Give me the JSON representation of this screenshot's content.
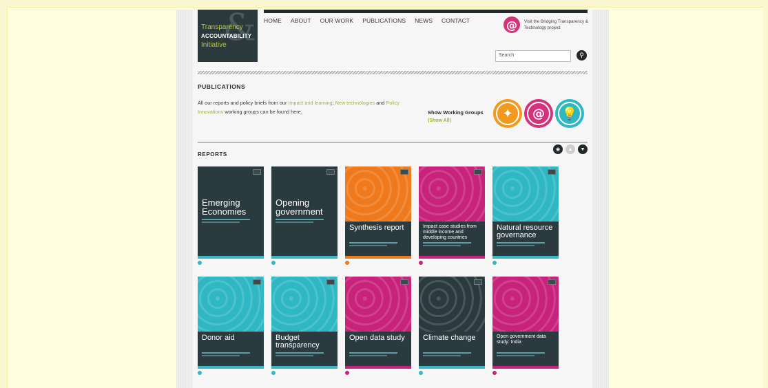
{
  "logo": {
    "line1": "Transparency",
    "line2": "ACCOUNTABILITY",
    "line3": "Initiative",
    "amp": "&"
  },
  "nav": [
    "HOME",
    "ABOUT",
    "OUR WORK",
    "PUBLICATIONS",
    "NEWS",
    "CONTACT"
  ],
  "bridge": {
    "text": "Visit the Bridging Transparency & Technology project",
    "icon": "at-icon"
  },
  "search": {
    "placeholder": "Search"
  },
  "publications": {
    "heading": "PUBLICATIONS",
    "intro_before": "All our reports and policy briefs from our ",
    "link1": "Impact and learning",
    "sep1": "; ",
    "link2": "New technologies",
    "and": " and ",
    "link3": "Policy Innovations",
    "intro_after": " working groups can be found here.",
    "show_groups": "Show Working Groups",
    "show_all": "(Show All)",
    "groups": [
      {
        "name": "compass-icon",
        "color": "#f29a1f",
        "glyph": "✦"
      },
      {
        "name": "at-icon",
        "color": "#d5327c",
        "glyph": "@"
      },
      {
        "name": "lightbulb-icon",
        "color": "#2fb8c4",
        "glyph": "💡"
      }
    ]
  },
  "reports": {
    "heading": "REPORTS",
    "controls": [
      {
        "name": "rss-icon",
        "glyph": "◉",
        "color": "#23292b"
      },
      {
        "name": "up-arrow-icon",
        "glyph": "▲",
        "color": "#cfcfcf"
      },
      {
        "name": "down-arrow-icon",
        "glyph": "▼",
        "color": "#23292b"
      }
    ],
    "items": [
      {
        "title": "Emerging Economies",
        "bg": "#2b3a3f",
        "accent": "#36b7c3",
        "dot": "#36b7c3"
      },
      {
        "title": "Opening government",
        "bg": "#2b3a3f",
        "accent": "#36b7c3",
        "dot": "#36b7c3"
      },
      {
        "title": "Synthesis report",
        "bg": "#ef7a1d",
        "accent": "#ef7a1d",
        "dot": "#ef7a1d"
      },
      {
        "title": "Impact case studies from middle income and developing countries",
        "bg": "#c8237a",
        "accent": "#c8237a",
        "dot": "#c8237a"
      },
      {
        "title": "Natural resource governance",
        "bg": "#2fb8c4",
        "accent": "#36b7c3",
        "dot": "#36b7c3"
      },
      {
        "title": "Donor aid",
        "bg": "#2fb8c4",
        "accent": "#36b7c3",
        "dot": "#36b7c3"
      },
      {
        "title": "Budget transparency",
        "bg": "#2fb8c4",
        "accent": "#36b7c3",
        "dot": "#36b7c3"
      },
      {
        "title": "Open data study",
        "bg": "#c8237a",
        "accent": "#c8237a",
        "dot": "#c8237a"
      },
      {
        "title": "Climate change",
        "bg": "#2b3a3f",
        "accent": "#36b7c3",
        "dot": "#36b7c3"
      },
      {
        "title": "Open government data study: India",
        "bg": "#c8237a",
        "accent": "#c8237a",
        "dot": "#c8237a"
      }
    ]
  }
}
